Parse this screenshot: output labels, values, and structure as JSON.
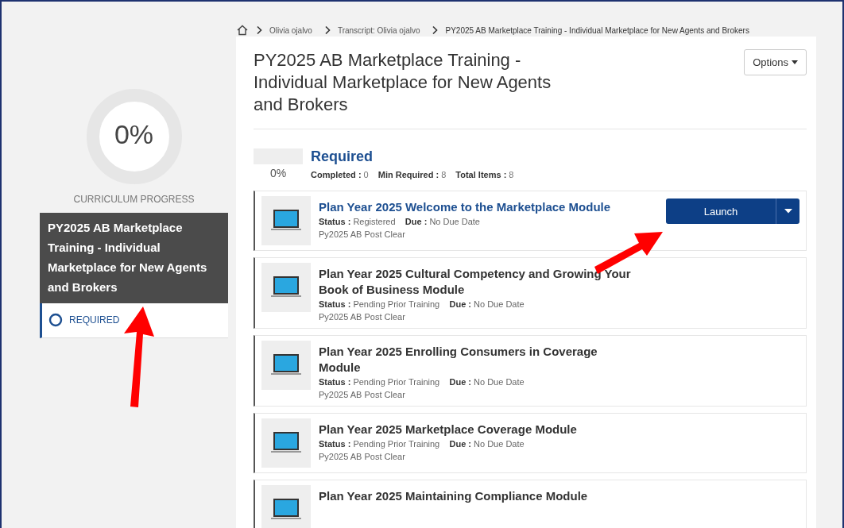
{
  "breadcrumb": [
    "Olivia ojalvo",
    "Transcript: Olivia ojalvo",
    "PY2025 AB Marketplace Training - Individual Marketplace for New Agents and Brokers"
  ],
  "curriculum": {
    "percent": "0%",
    "level": 0,
    "label": "CURRICULUM PROGRESS",
    "title": "PY2025 AB Marketplace Training - Individual Marketplace for New Agents and Brokers",
    "section": "REQUIRED"
  },
  "page": {
    "title": "PY2025 AB Marketplace Training - Individual Marketplace for New Agents and Brokers",
    "options": "Options"
  },
  "required": {
    "heading": "Required",
    "percent": "0%",
    "level": 0,
    "stats": [
      {
        "label": "Completed :",
        "value": "0"
      },
      {
        "label": "Min Required :",
        "value": "8"
      },
      {
        "label": "Total Items :",
        "value": "8"
      }
    ]
  },
  "items": [
    {
      "title": "Plan Year 2025 Welcome to the Marketplace Module",
      "available": true,
      "status_label": "Status :",
      "status": "Registered",
      "due_label": "Due :",
      "due": "No Due Date",
      "tag": "Py2025 AB Post Clear",
      "action": "Launch"
    },
    {
      "title": "Plan Year 2025 Cultural Competency and Growing Your Book of Business Module",
      "available": false,
      "status_label": "Status :",
      "status": "Pending Prior Training",
      "due_label": "Due :",
      "due": "No Due Date",
      "tag": "Py2025 AB Post Clear"
    },
    {
      "title": "Plan Year 2025 Enrolling Consumers in Coverage Module",
      "available": false,
      "status_label": "Status :",
      "status": "Pending Prior Training",
      "due_label": "Due :",
      "due": "No Due Date",
      "tag": "Py2025 AB Post Clear"
    },
    {
      "title": "Plan Year 2025 Marketplace Coverage Module",
      "available": false,
      "status_label": "Status :",
      "status": "Pending Prior Training",
      "due_label": "Due :",
      "due": "No Due Date",
      "tag": "Py2025 AB Post Clear"
    },
    {
      "title": "Plan Year 2025 Maintaining Compliance Module",
      "available": false
    }
  ]
}
